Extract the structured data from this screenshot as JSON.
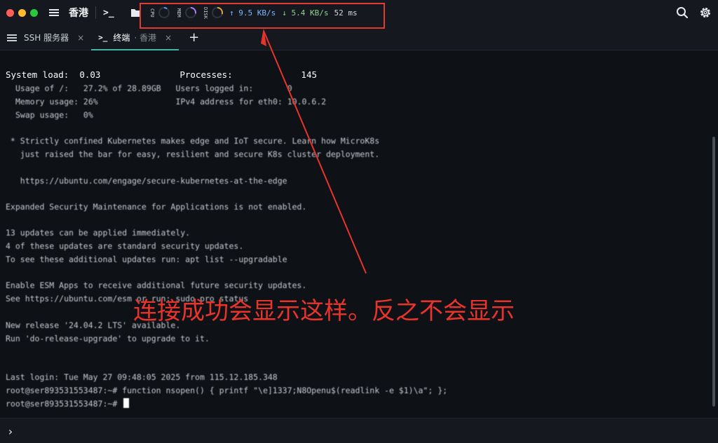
{
  "window": {
    "title": "香港",
    "colors": {
      "accent": "#3fb6a8",
      "annotation": "#e8342b"
    }
  },
  "titlebar": {
    "icons": [
      "hamburger-icon",
      "terminal-prompt-icon",
      "folder-icon",
      "search-icon",
      "gear-icon"
    ],
    "prompt_glyph": ">_",
    "monitor": {
      "cpu_label": "CPU",
      "mem_label": "MEM",
      "disk_label": "DISK",
      "cpu_level": 0.1,
      "mem_level": 0.28,
      "disk_level": 0.3,
      "upload": "↑ 9.5 KB/s",
      "download": "↓ 5.4 KB/s",
      "latency": "52 ms"
    }
  },
  "tabs": [
    {
      "label": "SSH 服务器",
      "sub": "",
      "close": "×"
    },
    {
      "label": "终端",
      "sub": "· 香港",
      "close": "×"
    }
  ],
  "add_tab_label": "+",
  "terminal": {
    "lines": [
      "System load:  0.03               Processes:             145",
      "Usage of /:   27.2% of 28.89GB   Users logged in:       0",
      "Memory usage: 26%                IPv4 address for eth0: 10.0.6.2",
      "Swap usage:   0%",
      "",
      " * Strictly confined Kubernetes makes edge and IoT secure. Learn how MicroK8s",
      "   just raised the bar for easy, resilient and secure K8s cluster deployment.",
      "",
      "   https://ubuntu.com/engage/secure-kubernetes-at-the-edge",
      "",
      "Expanded Security Maintenance for Applications is not enabled.",
      "",
      "13 updates can be applied immediately.",
      "4 of these updates are standard security updates.",
      "To see these additional updates run: apt list --upgradable",
      "",
      "Enable ESM Apps to receive additional future security updates.",
      "See https://ubuntu.com/esm or run: sudo pro status",
      "",
      "New release '24.04.2 LTS' available.",
      "Run 'do-release-upgrade' to upgrade to it.",
      "",
      "",
      "Last login: Tue May 27 09:48:05 2025 from 115.12.185.348",
      "root@ser893531553487:~# function nsopen() { printf \"\\e]1337;N8Openu$(readlink -e $1)\\a\"; };",
      "root@ser893531553487:~# "
    ],
    "annotation": "连接成功会显示这样。反之不会显示"
  },
  "bottombar": {
    "prompt": "›"
  }
}
